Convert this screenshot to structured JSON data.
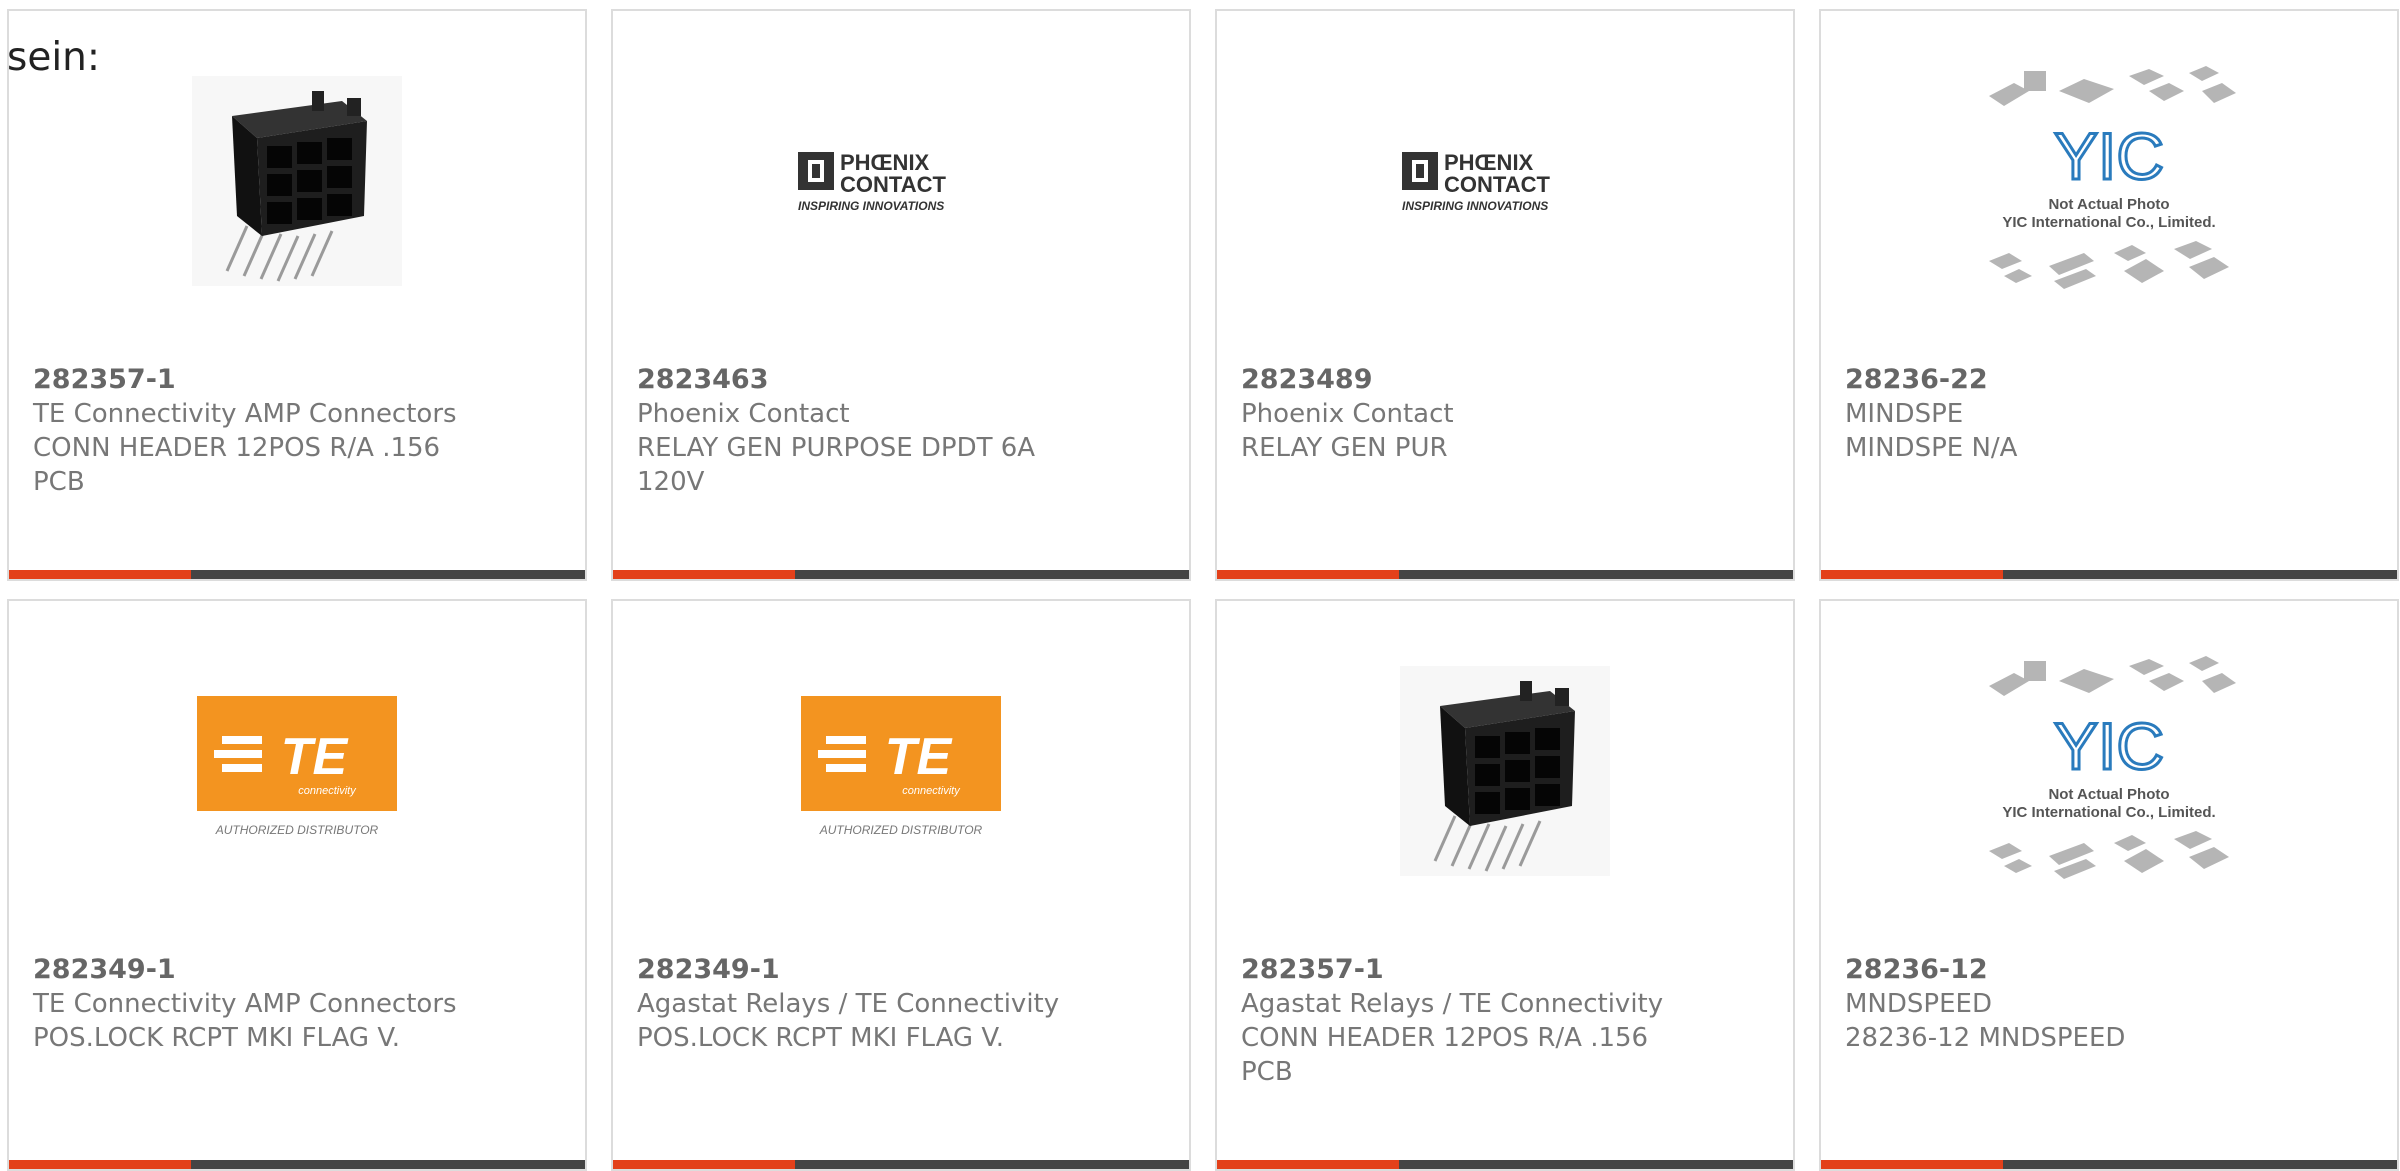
{
  "header": {
    "lead_text": "sein:"
  },
  "colors": {
    "accent": "#e3401a",
    "bar": "#444444",
    "te_orange": "#f39420"
  },
  "cards": [
    {
      "part": "282357-1",
      "maker": "TE Connectivity AMP Connectors",
      "desc": "CONN HEADER 12POS R/A .156 PCB",
      "image": "connector-photo"
    },
    {
      "part": "2823463",
      "maker": "Phoenix Contact",
      "desc": "RELAY GEN PURPOSE DPDT 6A 120V",
      "image": "phoenix-logo",
      "logo": {
        "line1": "PHŒNIX",
        "line2": "CONTACT",
        "tagline": "INSPIRING INNOVATIONS"
      }
    },
    {
      "part": "2823489",
      "maker": "Phoenix Contact",
      "desc": "RELAY GEN PUR",
      "image": "phoenix-logo",
      "logo": {
        "line1": "PHŒNIX",
        "line2": "CONTACT",
        "tagline": "INSPIRING INNOVATIONS"
      }
    },
    {
      "part": "28236-22",
      "maker": "MINDSPE",
      "desc": "MINDSPE N/A",
      "image": "yic-placeholder",
      "logo": {
        "mark": "YIC",
        "line1": "Not Actual Photo",
        "line2": "YIC International Co., Limited."
      }
    },
    {
      "part": "282349-1",
      "maker": "TE Connectivity AMP Connectors",
      "desc": "POS.LOCK RCPT MKI FLAG V.",
      "image": "te-logo",
      "logo": {
        "mark": "TE",
        "sub": "connectivity",
        "caption": "AUTHORIZED DISTRIBUTOR"
      }
    },
    {
      "part": "282349-1",
      "maker": "Agastat Relays / TE Connectivity",
      "desc": "POS.LOCK RCPT MKI FLAG V.",
      "image": "te-logo",
      "logo": {
        "mark": "TE",
        "sub": "connectivity",
        "caption": "AUTHORIZED DISTRIBUTOR"
      }
    },
    {
      "part": "282357-1",
      "maker": "Agastat Relays / TE Connectivity",
      "desc": "CONN HEADER 12POS R/A .156 PCB",
      "image": "connector-photo"
    },
    {
      "part": "28236-12",
      "maker": "MNDSPEED",
      "desc": "28236-12 MNDSPEED",
      "image": "yic-placeholder",
      "logo": {
        "mark": "YIC",
        "line1": "Not Actual Photo",
        "line2": "YIC International Co., Limited."
      }
    }
  ]
}
